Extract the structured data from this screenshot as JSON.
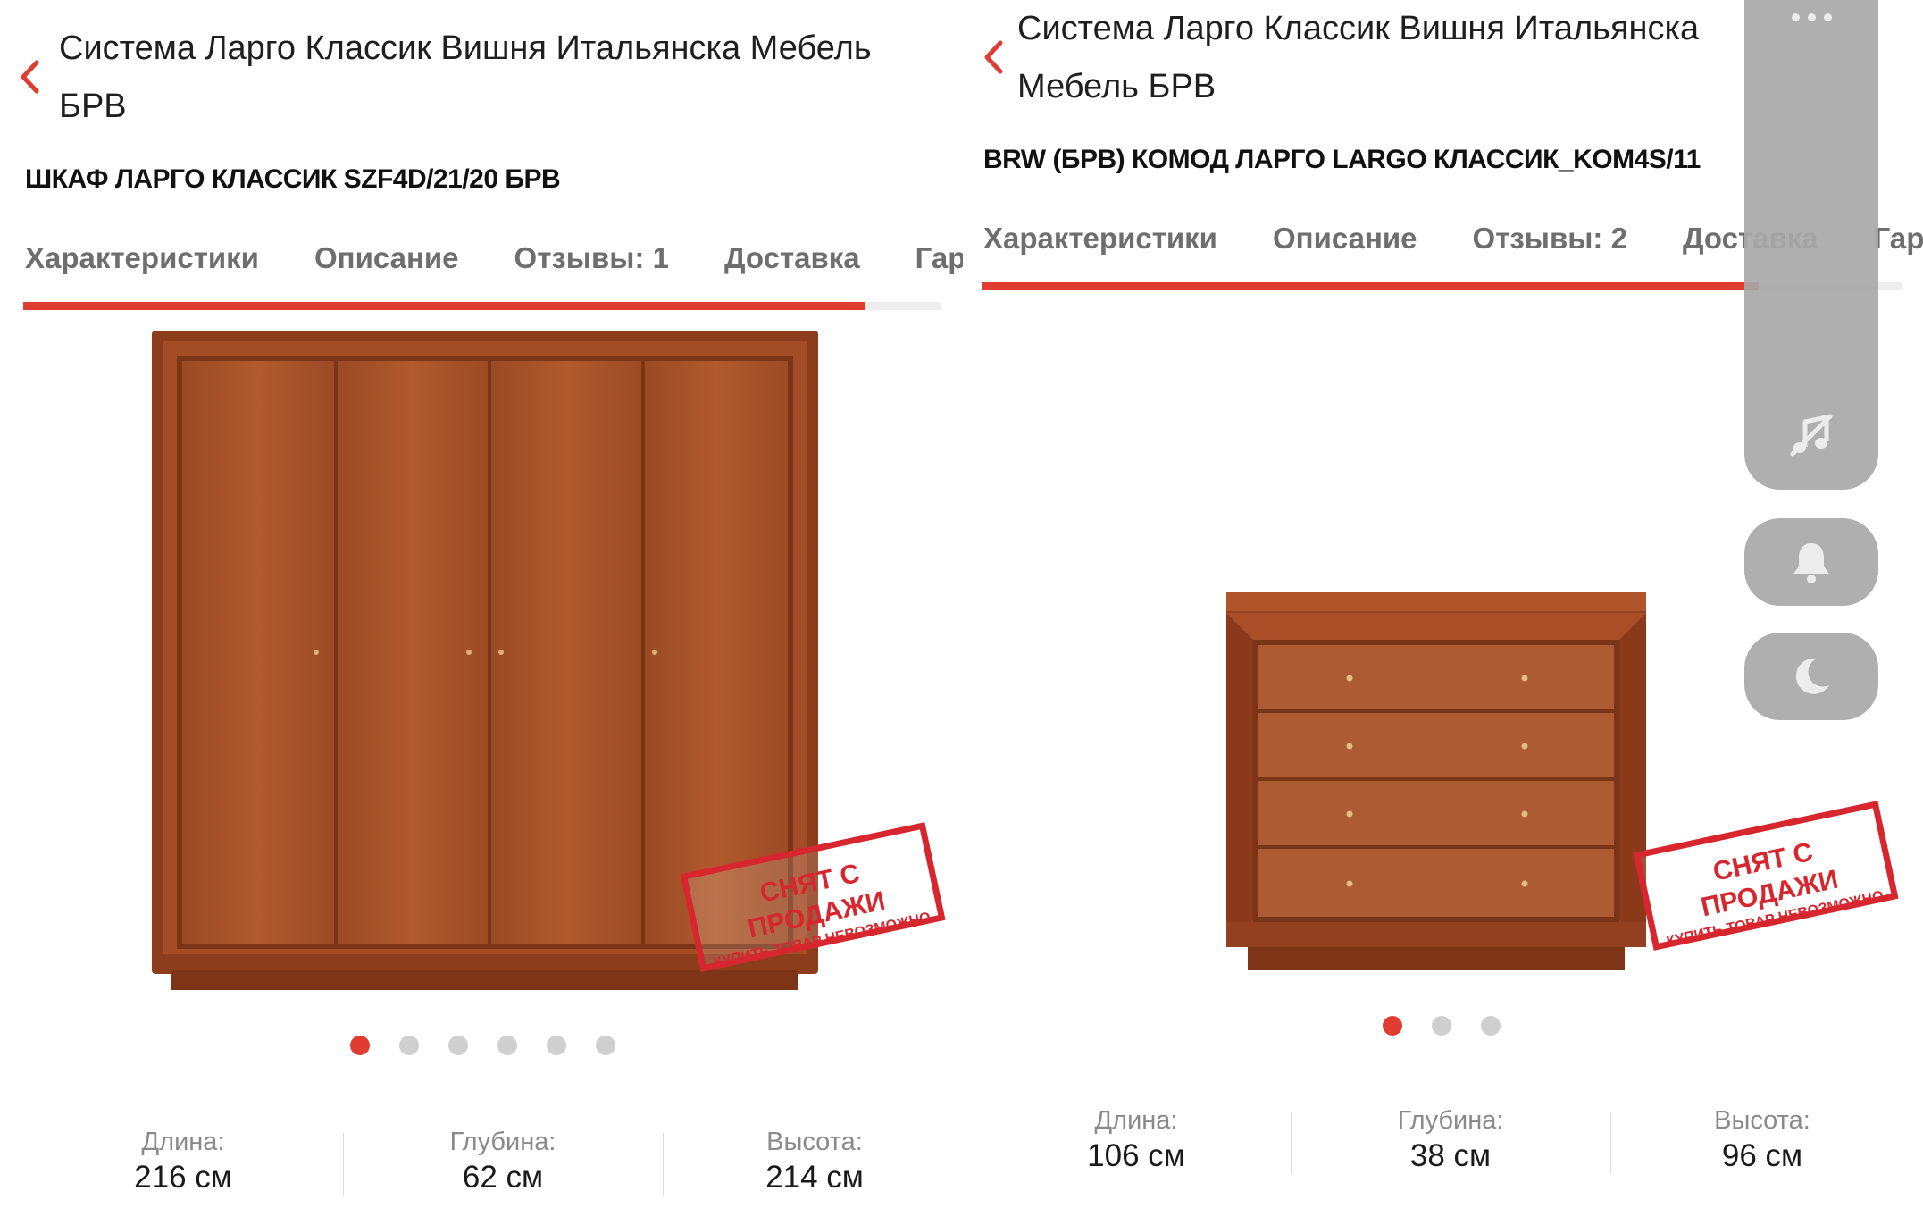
{
  "left": {
    "header_title": "Система Ларго Классик Вишня Итальянска Мебель БРВ",
    "product_name": "ШКАФ ЛАРГО КЛАССИК SZF4D/21/20 БРВ",
    "tabs": [
      "Характеристики",
      "Описание",
      "Отзывы: 1",
      "Доставка",
      "Гаранти"
    ],
    "stamp": {
      "line1": "СНЯТ С ПРОДАЖИ",
      "line2": "купить товар невозможно"
    },
    "carousel": {
      "total": 6,
      "active": 1
    },
    "dimensions": [
      {
        "label": "Длина:",
        "value": "216 см"
      },
      {
        "label": "Глубина:",
        "value": "62 см"
      },
      {
        "label": "Высота:",
        "value": "214 см"
      }
    ]
  },
  "right": {
    "header_title": "Система Ларго Классик Вишня Итальянска Мебель БРВ",
    "product_name": "BRW (БРВ) КОМОД ЛАРГО LARGO КЛАССИК_KOM4S/11",
    "tabs": [
      "Характеристики",
      "Описание",
      "Отзывы: 2",
      "Доставка",
      "Гарантия"
    ],
    "stamp": {
      "line1": "СНЯТ С ПРОДАЖИ",
      "line2": "купить товар невозможно"
    },
    "carousel": {
      "total": 3,
      "active": 1
    },
    "dimensions": [
      {
        "label": "Длина:",
        "value": "106 см"
      },
      {
        "label": "Глубина:",
        "value": "38 см"
      },
      {
        "label": "Высота:",
        "value": "96 см"
      }
    ]
  },
  "side_toolbar": {
    "icons": [
      "more-icon",
      "music-off-icon",
      "bell-icon",
      "moon-icon"
    ]
  },
  "colors": {
    "accent": "#e03c31",
    "stamp": "#d7262e",
    "wood": "#a8522a",
    "wood_dark": "#7e3416",
    "toolbar": "#a8a8a8"
  }
}
